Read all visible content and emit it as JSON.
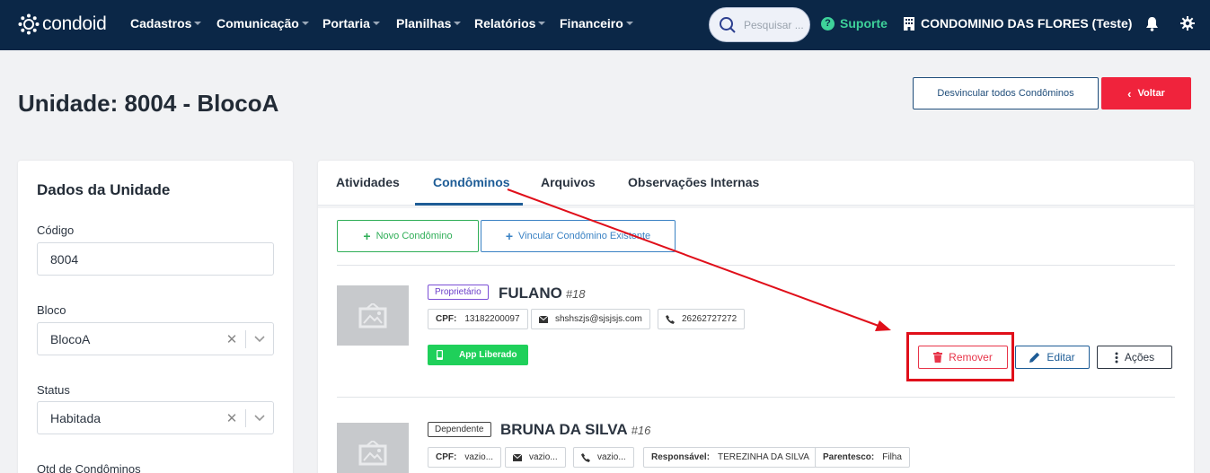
{
  "nav": {
    "logo": "condoid",
    "menu": [
      {
        "label": "Cadastros"
      },
      {
        "label": "Comunicação"
      },
      {
        "label": "Portaria"
      },
      {
        "label": "Planilhas"
      },
      {
        "label": "Relatórios"
      },
      {
        "label": "Financeiro"
      }
    ],
    "search_placeholder": "Pesquisar ...",
    "support_label": "Suporte",
    "condo_label": "CONDOMINIO DAS FLORES (Teste)",
    "colors": {
      "bar": "#0b2747",
      "support": "#3ed29a"
    }
  },
  "header": {
    "title": "Unidade: 8004 - BlocoA",
    "desvincular_label": "Desvincular todos Condôminos",
    "voltar_label": "Voltar"
  },
  "unit_card": {
    "title": "Dados da Unidade",
    "fields": [
      {
        "label": "Código",
        "value": "8004"
      },
      {
        "label": "Bloco",
        "value": "BlocoA"
      },
      {
        "label": "Status",
        "value": "Habitada"
      },
      {
        "label": "Qtd de Condôminos"
      }
    ]
  },
  "tabs": [
    {
      "label": "Atividades"
    },
    {
      "label": "Condôminos",
      "active": true
    },
    {
      "label": "Arquivos"
    },
    {
      "label": "Observações Internas"
    }
  ],
  "actions": {
    "novo_label": "Novo Condômino",
    "vincular_label": "Vincular Condômino Existente"
  },
  "residents": [
    {
      "role": "Proprietário",
      "name": "FULANO",
      "id": "#18",
      "cpf_label": "CPF:",
      "cpf": "13182200097",
      "email": "shshszjs@sjsjsjs.com",
      "phone": "26262727272",
      "app_status": "App Liberado",
      "remover_label": "Remover",
      "editar_label": "Editar",
      "acoes_label": "Ações"
    },
    {
      "role": "Dependente",
      "name": "BRUNA DA SILVA",
      "id": "#16",
      "cpf_label": "CPF:",
      "cpf": "vazio...",
      "email": "vazio...",
      "phone": "vazio...",
      "responsavel_label": "Responsável:",
      "responsavel": "TEREZINHA DA SILVA",
      "parentesco_label": "Parentesco:",
      "parentesco": "Filha"
    }
  ],
  "annotation_color": "#e00f1a"
}
